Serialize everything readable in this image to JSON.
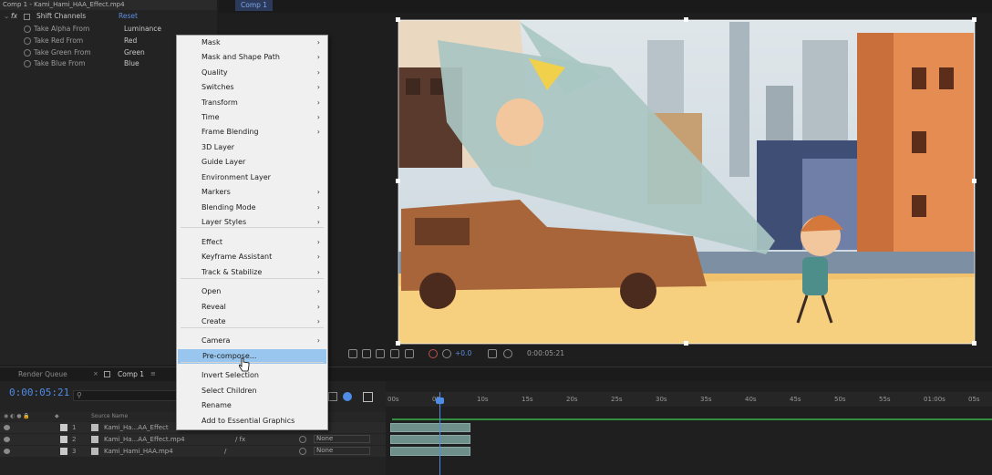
{
  "effect_controls": {
    "title": "Comp 1 - Kami_Hami_HAA_Effect.mp4",
    "effect_name": "Shift Channels",
    "reset_label": "Reset",
    "rows": [
      {
        "label": "Take Alpha From",
        "value": "Luminance"
      },
      {
        "label": "Take Red From",
        "value": "Red"
      },
      {
        "label": "Take Green From",
        "value": "Green"
      },
      {
        "label": "Take Blue From",
        "value": "Blue"
      }
    ]
  },
  "viewer": {
    "tab": "Comp 1",
    "zoom": "+0.0",
    "timecode": "0:00:05:21"
  },
  "context_menu": {
    "items": [
      {
        "label": "Mask",
        "submenu": true
      },
      {
        "label": "Mask and Shape Path",
        "submenu": true
      },
      {
        "label": "Quality",
        "submenu": true
      },
      {
        "label": "Switches",
        "submenu": true
      },
      {
        "label": "Transform",
        "submenu": true
      },
      {
        "label": "Time",
        "submenu": true
      },
      {
        "label": "Frame Blending",
        "submenu": true
      },
      {
        "label": "3D Layer",
        "submenu": false
      },
      {
        "label": "Guide Layer",
        "submenu": false
      },
      {
        "label": "Environment Layer",
        "submenu": false
      },
      {
        "label": "Markers",
        "submenu": true
      },
      {
        "label": "Blending Mode",
        "submenu": true
      },
      {
        "label": "Layer Styles",
        "submenu": true
      },
      {
        "label": "Effect",
        "submenu": true
      },
      {
        "label": "Keyframe Assistant",
        "submenu": true
      },
      {
        "label": "Track & Stabilize",
        "submenu": true
      },
      {
        "label": "Open",
        "submenu": true
      },
      {
        "label": "Reveal",
        "submenu": true
      },
      {
        "label": "Create",
        "submenu": true
      },
      {
        "label": "Camera",
        "submenu": true
      },
      {
        "label": "Pre-compose...",
        "submenu": false
      },
      {
        "label": "Invert Selection",
        "submenu": false
      },
      {
        "label": "Select Children",
        "submenu": false
      },
      {
        "label": "Rename",
        "submenu": false
      },
      {
        "label": "Add to Essential Graphics",
        "submenu": false
      }
    ],
    "highlighted": "Pre-compose...",
    "arrow": "›"
  },
  "timeline": {
    "render_queue_tab": "Render Queue",
    "comp_tab": "Comp 1",
    "timecode": "0:00:05:21",
    "column_source_name": "Source Name",
    "ruler_ticks": [
      "00s",
      "05s",
      "10s",
      "15s",
      "20s",
      "25s",
      "30s",
      "35s",
      "40s",
      "45s",
      "50s",
      "55s",
      "01:00s",
      "05s"
    ],
    "layers": [
      {
        "num": "1",
        "name": "Kami_Ha...AA_Effect",
        "mode": ""
      },
      {
        "num": "2",
        "name": "Kami_Ha...AA_Effect.mp4",
        "mode": "None"
      },
      {
        "num": "3",
        "name": "Kami_Hami_HAA.mp4",
        "mode": "None"
      }
    ]
  },
  "colors": {
    "accent_blue": "#4f8ce6",
    "menu_highlight": "#99c6ef"
  }
}
